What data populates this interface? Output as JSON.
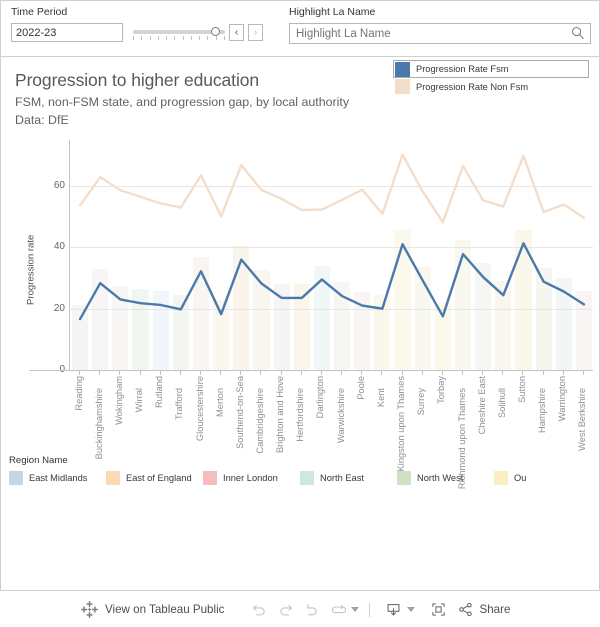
{
  "filters": {
    "time_period": {
      "label": "Time Period",
      "value": "2022-23",
      "prev_label": "‹",
      "next_label": "›"
    },
    "highlight": {
      "label": "Highlight La Name",
      "placeholder": "Highlight La Name",
      "value": ""
    }
  },
  "sheet": {
    "title": "Progression to higher education",
    "subtitle": "FSM, non-FSM state, and progression gap, by local authority",
    "source": "Data: DfE"
  },
  "measure_legend": {
    "items": [
      {
        "label": "Progression Rate Fsm",
        "color": "#4a7aab",
        "selected": true
      },
      {
        "label": "Progression Rate Non Fsm",
        "color": "#f3decb",
        "selected": false
      }
    ]
  },
  "region_legend": {
    "title": "Region Name",
    "items": [
      {
        "label": "East Midlands",
        "color": "#c6d4e3"
      },
      {
        "label": "East of England",
        "color": "#fad9b4"
      },
      {
        "label": "Inner London",
        "color": "#f6bdc0"
      },
      {
        "label": "North East",
        "color": "#cfe7e2"
      },
      {
        "label": "North West",
        "color": "#cfe2c4"
      },
      {
        "label": "Ou",
        "color": "#fbeec0"
      }
    ]
  },
  "chart_data": {
    "type": "line",
    "title": "Progression to higher education",
    "subtitle": "FSM, non-FSM state, and progression gap, by local authority",
    "xlabel": "",
    "ylabel": "Progression rate",
    "ylim": [
      0,
      75
    ],
    "yticks": [
      0,
      20,
      40,
      60
    ],
    "grid": true,
    "legend_position": "top-right",
    "categories": [
      "Reading",
      "Buckinghamshire",
      "Wokingham",
      "Wirral",
      "Rutland",
      "Trafford",
      "Gloucestershire",
      "Merton",
      "Southend-on-Sea",
      "Cambridgeshire",
      "Brighton and Hove",
      "Hertfordshire",
      "Darlington",
      "Warwickshire",
      "Poole",
      "Kent",
      "Kingston upon Thames",
      "Surrey",
      "Torbay",
      "Richmond upon Thames",
      "Cheshire East",
      "Solihull",
      "Sutton",
      "Hampshire",
      "Warrington",
      "West Berkshire"
    ],
    "series": [
      {
        "name": "Progression Rate Fsm",
        "color": "#4a7aab",
        "values": [
          16.6,
          28.3,
          23.0,
          21.8,
          21.2,
          19.8,
          32.2,
          18.2,
          36.0,
          28.2,
          23.5,
          23.5,
          29.5,
          24.1,
          21.0,
          20.0,
          41.0,
          29.2,
          17.5,
          37.8,
          30.3,
          24.4,
          41.3,
          28.8,
          25.6,
          21.4
        ]
      },
      {
        "name": "Progression Rate Non Fsm",
        "color": "#f3decb",
        "values": [
          53.7,
          62.9,
          58.6,
          56.5,
          54.3,
          53.0,
          63.5,
          50.1,
          66.8,
          58.7,
          55.8,
          52.2,
          52.3,
          55.5,
          58.8,
          50.9,
          70.2,
          58.2,
          48.2,
          66.5,
          55.3,
          53.3,
          69.8,
          51.5,
          54.0,
          49.6
        ]
      }
    ],
    "band_colors": [
      "#f7f4f4",
      "#f8f5f6",
      "#f8f6f4",
      "#f2f6f1",
      "#f2f5f9",
      "#f4f6f2",
      "#f9f5f3",
      "#fcf7ee",
      "#fbf4ec",
      "#f9f5ef",
      "#f7f4f6",
      "#fbf5ea",
      "#f1f6f6",
      "#f6f6f2",
      "#f9f5f2",
      "#fbf8eb",
      "#faf9ec",
      "#f8f7f0",
      "#fbf9ea",
      "#f9f8ee",
      "#f4f7f2",
      "#faf6ee",
      "#faf8ea",
      "#f6f6f1",
      "#f3f6f6",
      "#f8f5f4"
    ]
  },
  "toolbar": {
    "tableau_label": "View on Tableau Public",
    "undo_label": "Undo",
    "redo_label": "Redo",
    "revert_label": "Revert",
    "refresh_label": "Refresh",
    "download_label": "Download",
    "fullscreen_label": "Full Screen",
    "share_label": "Share"
  }
}
